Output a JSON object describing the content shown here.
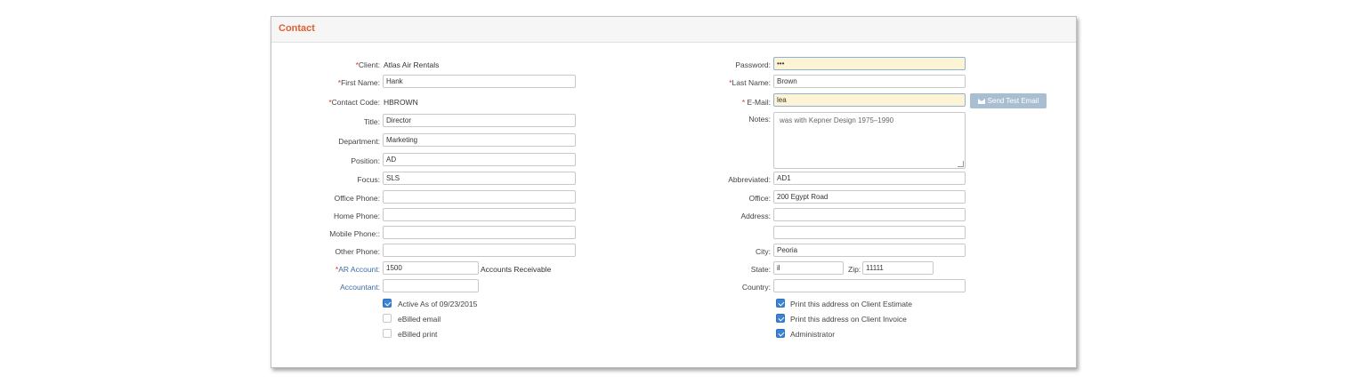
{
  "panel": {
    "title": "Contact"
  },
  "left": {
    "client": {
      "label": "Client:",
      "value": "Atlas Air Rentals"
    },
    "first_name": {
      "label": "First Name:",
      "value": "Hank"
    },
    "contact_code": {
      "label": "Contact Code:",
      "value": "HBROWN"
    },
    "title": {
      "label": "Title:",
      "value": "Director"
    },
    "department": {
      "label": "Department:",
      "value": "Marketing"
    },
    "position": {
      "label": "Position:",
      "value": "AD"
    },
    "focus": {
      "label": "Focus:",
      "value": "SLS"
    },
    "office_phone": {
      "label": "Office Phone:",
      "value": ""
    },
    "home_phone": {
      "label": "Home Phone:",
      "value": ""
    },
    "mobile_phone": {
      "label": "Mobile Phone::",
      "value": ""
    },
    "other_phone": {
      "label": "Other Phone:",
      "value": ""
    },
    "ar_account": {
      "label": "AR Account:",
      "value": "1500",
      "description": "Accounts Receivable"
    },
    "accountant": {
      "label": "Accountant:",
      "value": ""
    },
    "checks": [
      {
        "label": "Active As of 09/23/2015",
        "checked": true
      },
      {
        "label": "eBilled email",
        "checked": false
      },
      {
        "label": "eBilled print",
        "checked": false
      }
    ]
  },
  "right": {
    "password": {
      "label": "Password:",
      "value": "•••"
    },
    "last_name": {
      "label": "Last Name:",
      "value": "Brown"
    },
    "email": {
      "label": "E-Mail:",
      "value": "lea"
    },
    "send_test_email": "Send Test Email",
    "notes": {
      "label": "Notes:",
      "value": "was with Kepner Design 1975–1990"
    },
    "abbreviated": {
      "label": "Abbreviated:",
      "value": "AD1"
    },
    "office": {
      "label": "Office:",
      "value": "200 Egypt Road"
    },
    "address": {
      "label": "Address:",
      "value": "",
      "value2": ""
    },
    "city": {
      "label": "City:",
      "value": "Peoria"
    },
    "state": {
      "label": "State:",
      "value": "il"
    },
    "zip": {
      "label": "Zip:",
      "value": "11111"
    },
    "country": {
      "label": "Country:",
      "value": ""
    },
    "checks": [
      {
        "label": "Print this address on Client Estimate",
        "checked": true
      },
      {
        "label": "Print this address on Client Invoice",
        "checked": true
      },
      {
        "label": "Administrator",
        "checked": true
      }
    ]
  },
  "required_mark": "*"
}
